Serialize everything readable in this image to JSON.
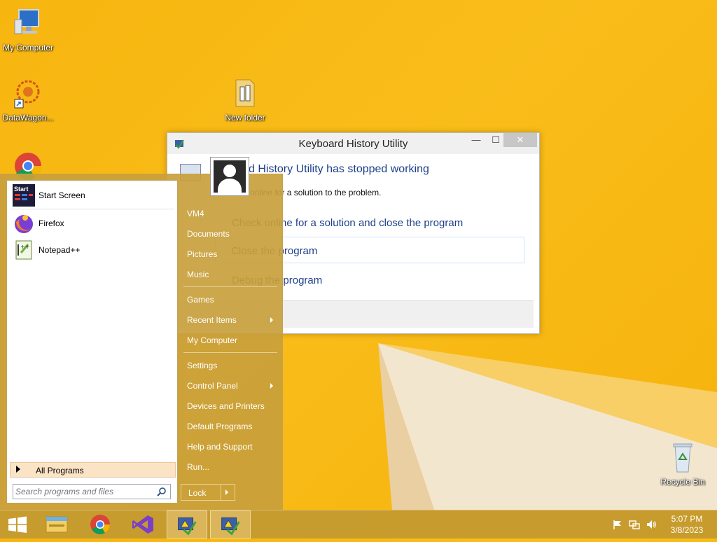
{
  "desktop": {
    "icons": [
      {
        "label": "My Computer"
      },
      {
        "label": "DataWagon..."
      },
      {
        "label": "New folder"
      },
      {
        "label": "Recycle Bin"
      }
    ]
  },
  "dialog": {
    "title": "Keyboard History Utility",
    "heading": "d History Utility has stopped working",
    "subtext": "online for a solution to the problem.",
    "option_check": "Check online for a solution and close the program",
    "option_close": "Close the program",
    "option_debug": "Debug the program",
    "min_glyph": "—",
    "max_glyph": "☐",
    "close_glyph": "✕"
  },
  "start_menu": {
    "programs": [
      {
        "label": "Start Screen",
        "icon": "start-screen-icon"
      },
      {
        "label": "Firefox",
        "icon": "firefox-icon"
      },
      {
        "label": "Notepad++",
        "icon": "notepad-plus-plus-icon"
      }
    ],
    "start_icon_text": "Start",
    "all_programs": "All Programs",
    "search_placeholder": "Search programs and files",
    "right_items": [
      {
        "label": "VM4"
      },
      {
        "label": "Documents"
      },
      {
        "label": "Pictures"
      },
      {
        "label": "Music"
      },
      {
        "label": "Games"
      },
      {
        "label": "Recent Items"
      },
      {
        "label": "My Computer"
      },
      {
        "label": "Settings"
      },
      {
        "label": "Control Panel"
      },
      {
        "label": "Devices and Printers"
      },
      {
        "label": "Default Programs"
      },
      {
        "label": "Help and Support"
      },
      {
        "label": "Run..."
      }
    ],
    "lock": "Lock"
  },
  "taskbar": {
    "apps": [
      "windows-start-icon",
      "file-explorer-icon",
      "chrome-icon",
      "visual-studio-icon",
      "warning-app-icon",
      "warning-app-icon"
    ],
    "clock_time": "5:07 PM",
    "clock_date": "3/8/2023"
  },
  "colors": {
    "desktop": "#f7b50f",
    "start_menu": "#c8a03c",
    "dialog_heading": "#1e3f8a"
  }
}
